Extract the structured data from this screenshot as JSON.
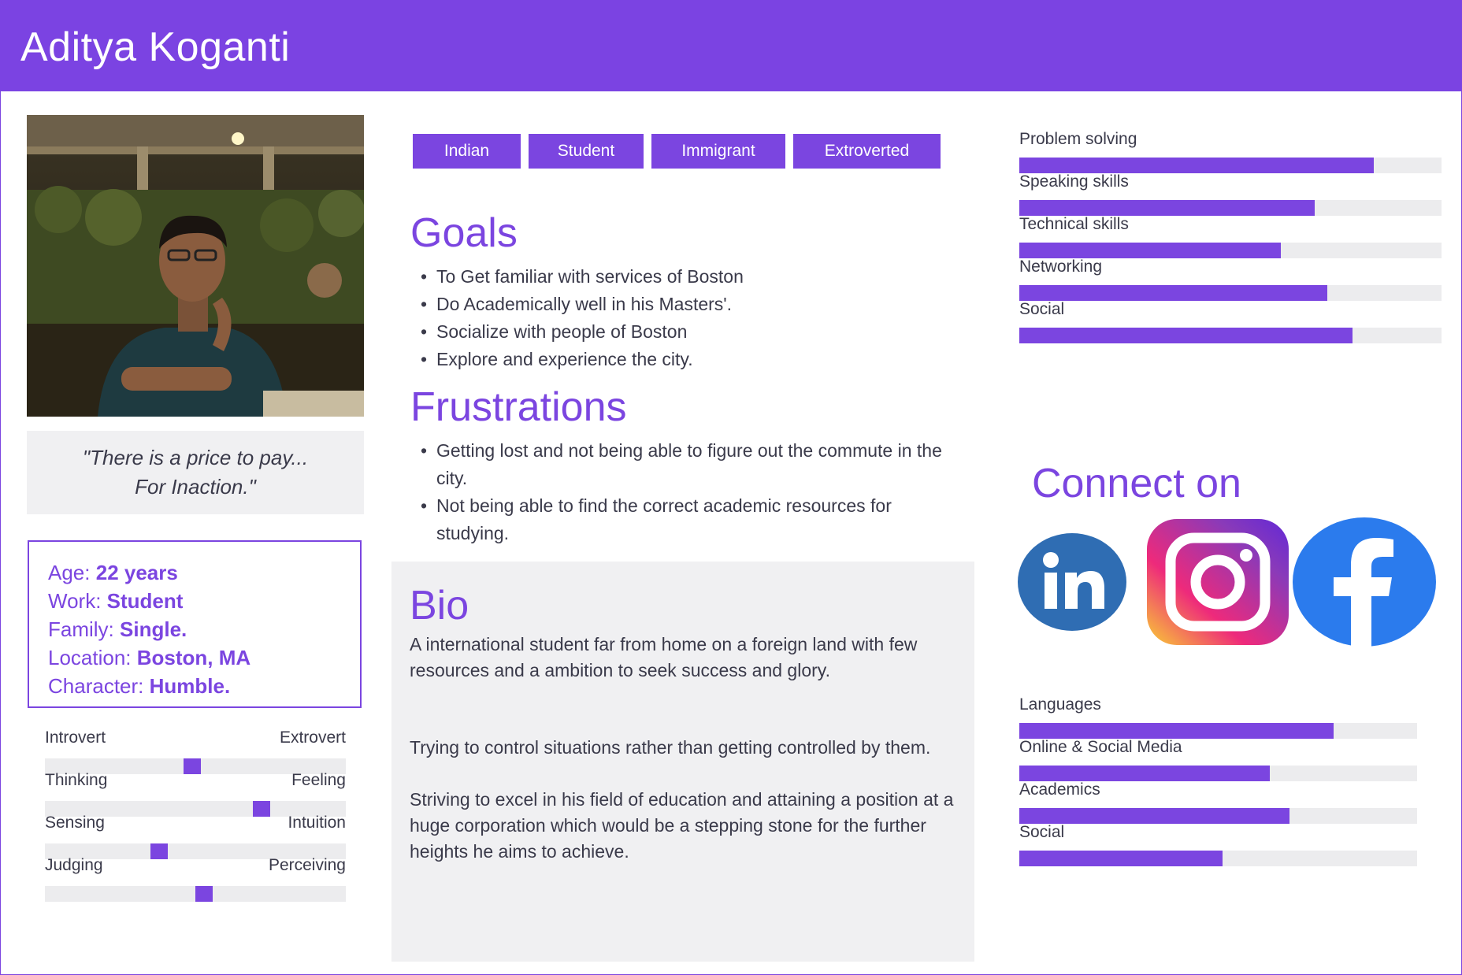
{
  "persona": {
    "name": "Aditya Koganti",
    "quote_line1": "\"There is a price to pay...",
    "quote_line2": "For Inaction.\""
  },
  "info": {
    "age_label": "Age:",
    "age_value": "22 years",
    "work_label": "Work:",
    "work_value": "Student",
    "family_label": "Family:",
    "family_value": "Single.",
    "location_label": "Location:",
    "location_value": "Boston, MA",
    "character_label": "Character:",
    "character_value": "Humble."
  },
  "traits": [
    {
      "left": "Introvert",
      "right": "Extrovert",
      "value": 0.49
    },
    {
      "left": "Thinking",
      "right": "Feeling",
      "value": 0.72
    },
    {
      "left": "Sensing",
      "right": "Intuition",
      "value": 0.38
    },
    {
      "left": "Judging",
      "right": "Perceiving",
      "value": 0.53
    }
  ],
  "tags": [
    "Indian",
    "Student",
    "Immigrant",
    "Extroverted"
  ],
  "goals": {
    "title": "Goals",
    "items": [
      "To Get familiar with services of Boston",
      "Do Academically well in his Masters'.",
      "Socialize with people of Boston",
      "Explore and experience the city."
    ]
  },
  "frustrations": {
    "title": "Frustrations",
    "items": [
      "Getting lost and not being able to figure out the commute in the city.",
      "Not being able to find the correct academic resources for studying."
    ]
  },
  "bio": {
    "title": "Bio",
    "para1": "A international student far from home on a foreign land with few resources and a ambition to seek success and glory.",
    "para2": "Trying to control situations rather than getting controlled by them.",
    "para3": "Striving to excel in his field of education and attaining a position at a huge corporation which would be a stepping stone for the further heights he aims to achieve."
  },
  "skills": [
    {
      "label": "Problem solving",
      "value": 0.84
    },
    {
      "label": "Speaking skills",
      "value": 0.7
    },
    {
      "label": "Technical skills",
      "value": 0.62
    },
    {
      "label": "Networking",
      "value": 0.73
    },
    {
      "label": "Social",
      "value": 0.79
    }
  ],
  "connect": {
    "title": "Connect on",
    "icons": [
      "linkedin-icon",
      "instagram-icon",
      "facebook-icon"
    ]
  },
  "channels": [
    {
      "label": "Languages",
      "value": 0.79
    },
    {
      "label": "Online & Social Media",
      "value": 0.63
    },
    {
      "label": "Academics",
      "value": 0.68
    },
    {
      "label": "Social",
      "value": 0.51
    }
  ],
  "colors": {
    "accent": "#7b45e0",
    "track": "#ececee",
    "panel": "#f0f0f2",
    "linkedin": "#2f6db3",
    "facebook": "#2b7bed"
  }
}
